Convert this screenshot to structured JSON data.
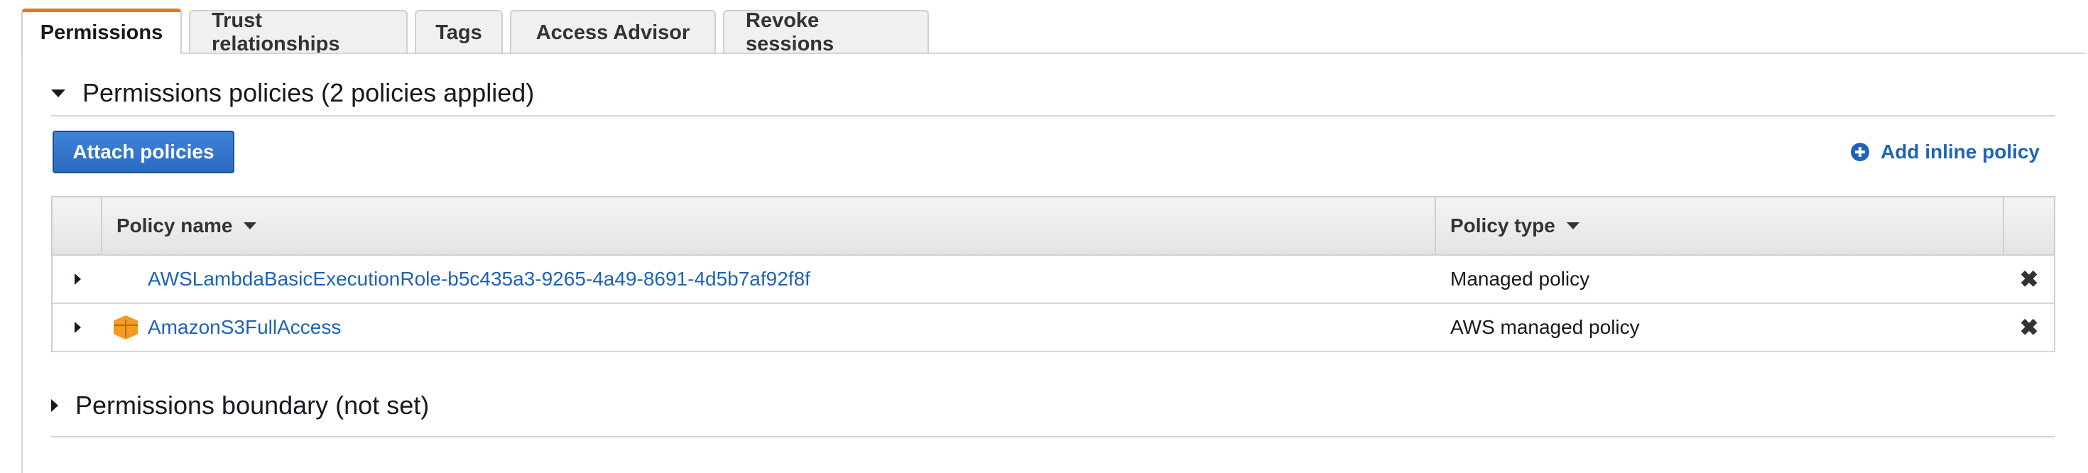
{
  "tabs": [
    {
      "label": "Permissions",
      "active": true
    },
    {
      "label": "Trust relationships",
      "active": false
    },
    {
      "label": "Tags",
      "active": false
    },
    {
      "label": "Access Advisor",
      "active": false
    },
    {
      "label": "Revoke sessions",
      "active": false
    }
  ],
  "permissions_section": {
    "title": "Permissions policies (2 policies applied)",
    "expanded": true,
    "attach_button": "Attach policies",
    "inline_link": "Add inline policy",
    "table": {
      "columns": [
        "Policy name",
        "Policy type"
      ],
      "rows": [
        {
          "name": "AWSLambdaBasicExecutionRole-b5c435a3-9265-4a49-8691-4d5b7af92f8f",
          "type": "Managed policy",
          "aws_icon": false
        },
        {
          "name": "AmazonS3FullAccess",
          "type": "AWS managed policy",
          "aws_icon": true
        }
      ]
    }
  },
  "boundary_section": {
    "title": "Permissions boundary (not set)",
    "expanded": false
  },
  "colors": {
    "accent_tab": "#e07b28",
    "link": "#1f63b5",
    "primary_button": "#2a6bc1"
  },
  "icons": {
    "expand_section": "caret-down-icon",
    "collapsed_section": "caret-right-icon",
    "sort": "sort-down-icon",
    "add": "plus-circle-icon",
    "remove": "close-icon",
    "aws_managed": "aws-cube-icon"
  }
}
